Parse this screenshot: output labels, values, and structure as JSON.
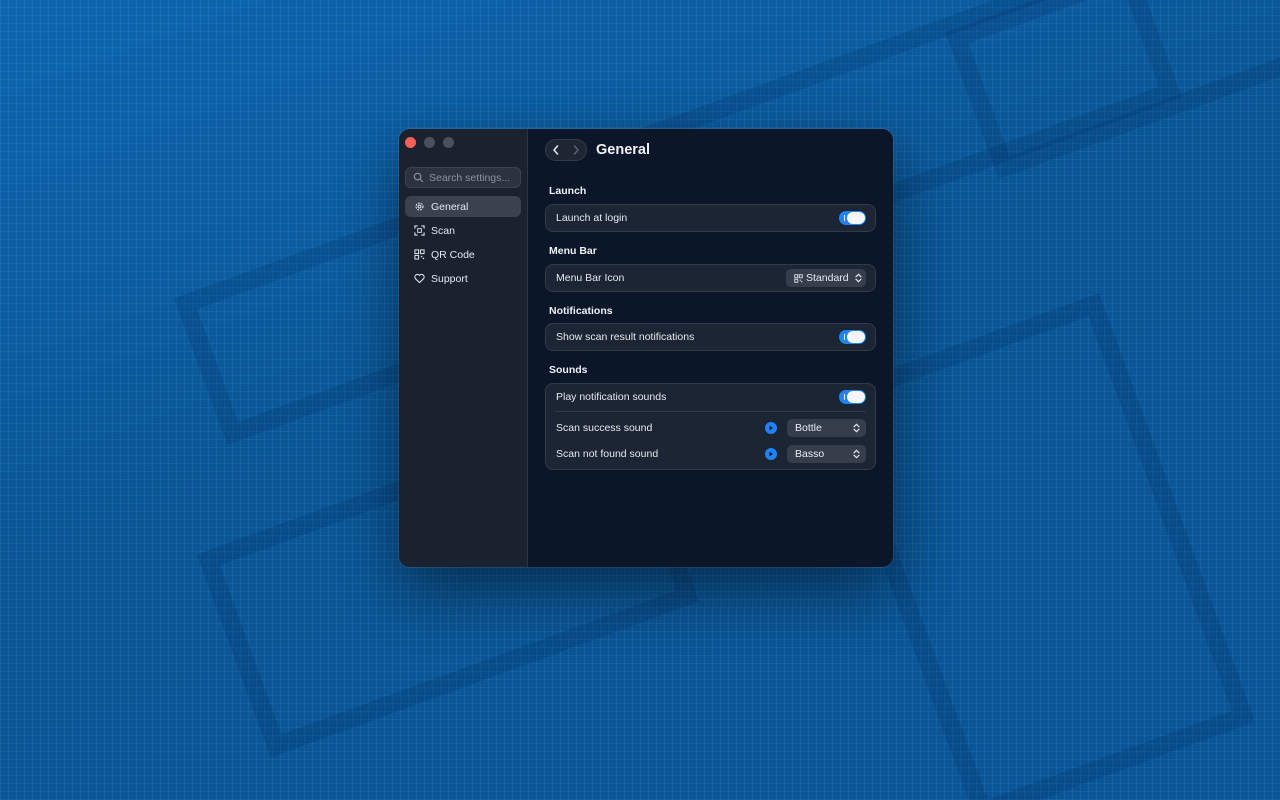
{
  "window": {
    "title": "General"
  },
  "sidebar": {
    "search_placeholder": "Search settings...",
    "items": [
      {
        "label": "General",
        "icon": "gear-icon",
        "active": true
      },
      {
        "label": "Scan",
        "icon": "scan-icon",
        "active": false
      },
      {
        "label": "QR Code",
        "icon": "qr-code-icon",
        "active": false
      },
      {
        "label": "Support",
        "icon": "heart-icon",
        "active": false
      }
    ]
  },
  "sections": {
    "launch": {
      "title": "Launch",
      "rows": [
        {
          "label": "Launch at login",
          "toggle": true
        }
      ]
    },
    "menu_bar": {
      "title": "Menu Bar",
      "rows": [
        {
          "label": "Menu Bar Icon",
          "value": "Standard",
          "icon": "qr-code-icon"
        }
      ]
    },
    "notifications": {
      "title": "Notifications",
      "rows": [
        {
          "label": "Show scan result notifications",
          "toggle": true
        }
      ]
    },
    "sounds": {
      "title": "Sounds",
      "rows": [
        {
          "label": "Play notification sounds",
          "toggle": true
        },
        {
          "label": "Scan success sound",
          "value": "Bottle"
        },
        {
          "label": "Scan not found sound",
          "value": "Basso"
        }
      ]
    }
  },
  "colors": {
    "accent": "#1f82f5",
    "window_bg": "#0b1628",
    "sidebar_bg": "#1a2230",
    "desktop_bg": "#0b5b9e"
  }
}
